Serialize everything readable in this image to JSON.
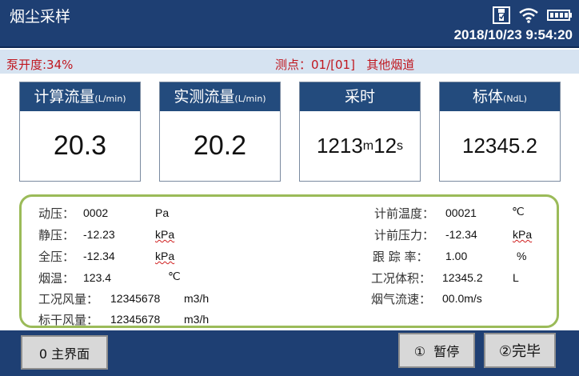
{
  "header": {
    "title": "烟尘采样",
    "datetime": "2018/10/23 9:54:20",
    "icons": [
      "usb-icon",
      "wifi-icon",
      "battery-icon"
    ]
  },
  "status": {
    "pump_text": "泵开度:34%",
    "point_text": "测点：01/[01]   其他烟道"
  },
  "cards": [
    {
      "title": "计算流量",
      "unit": "(L/min)",
      "value": "20.3"
    },
    {
      "title": "实测流量",
      "unit": "(L/min)",
      "value": "20.2"
    },
    {
      "title": "采时",
      "value_main": "1213",
      "value_m": "m",
      "value_sec": "12",
      "value_s": "s"
    },
    {
      "title": "标体",
      "unit": "(NdL)",
      "value": "12345.2"
    }
  ],
  "params": {
    "left": [
      {
        "label": "动压：",
        "value": "0002",
        "unit": "Pa"
      },
      {
        "label": "静压：",
        "value": "-12.23",
        "unit": "kPa"
      },
      {
        "label": "全压：",
        "value": "-12.34",
        "unit": "kPa"
      },
      {
        "label": "烟温：",
        "value": "123.4",
        "unit": "℃"
      },
      {
        "label": "工况风量：",
        "value": "12345678",
        "unit": "m3/h"
      },
      {
        "label": "标干风量：",
        "value": "12345678",
        "unit": "m3/h"
      }
    ],
    "right": [
      {
        "label": "计前温度：",
        "value": "00021",
        "unit": "℃"
      },
      {
        "label": "计前压力：",
        "value": "-12.34",
        "unit": "kPa"
      },
      {
        "label": "跟 踪 率：",
        "value": "1.00",
        "unit": "%"
      },
      {
        "label": "工况体积：",
        "value": "12345.2",
        "unit": "L"
      },
      {
        "label": "烟气流速：",
        "value": "00.0m/s",
        "unit": ""
      }
    ]
  },
  "footer": {
    "main_label": "0 主界面",
    "pause_label": "①  暂停",
    "finish_label": "②完毕"
  },
  "colors": {
    "header_bg": "#1e3f73",
    "status_bg": "#d6e3f1",
    "status_text": "#c0171f",
    "panel_border": "#9bbb59"
  }
}
